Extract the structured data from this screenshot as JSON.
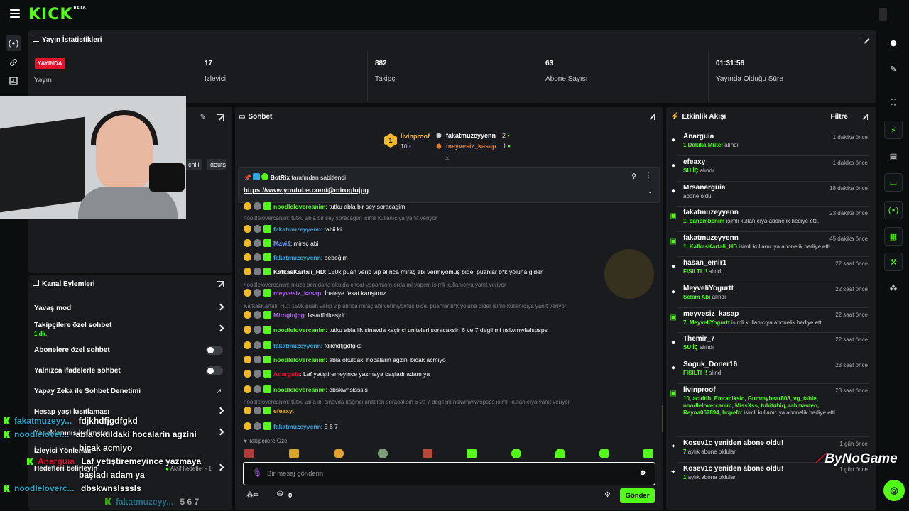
{
  "header": {
    "logo": "KICK",
    "logo_tag": "BETA"
  },
  "stats": {
    "title": "Yayın İstatistikleri",
    "live_badge": "YAYINDA",
    "items": [
      {
        "value": "",
        "label": "Yayın"
      },
      {
        "value": "17",
        "label": "İzleyici"
      },
      {
        "value": "882",
        "label": "Takipçi"
      },
      {
        "value": "63",
        "label": "Abone Sayısı"
      },
      {
        "value": "01:31:56",
        "label": "Yayında Olduğu Süre"
      }
    ]
  },
  "stream_info": {
    "tags": [
      "chill",
      "deuts"
    ]
  },
  "channel_actions": {
    "title": "Kanal Eylemleri",
    "rows": [
      {
        "label": "Yavaş mod",
        "sub": ""
      },
      {
        "label": "Takipçilere özel sohbet",
        "sub": "1 dk."
      },
      {
        "label": "Abonelere özel sohbet",
        "sub": ""
      },
      {
        "label": "Yalnızca ifadelerle sohbet",
        "sub": ""
      },
      {
        "label": "Yapay Zeka ile Sohbet Denetimi",
        "sub": ""
      },
      {
        "label": "Hesap yaşı kısıtlaması",
        "sub": ""
      },
      {
        "label": "Yasaklanmış kelimeler",
        "sub": ""
      },
      {
        "label": "İzleyici Yönlendir",
        "sub": ""
      },
      {
        "label": "Hedefleri belirleyin",
        "sub": ""
      }
    ],
    "goals_active": "Aktif hedefler - 1"
  },
  "overlay_chat": [
    {
      "user": "fakatmuzeyy...",
      "text": "fdjkhdfjgdfgkd"
    },
    {
      "user": "noodlelover...",
      "text": "abla okuldaki hocalarin agzini"
    },
    {
      "user": "",
      "text": "bicak acmiyo"
    },
    {
      "user": "Anarguia",
      "text": "Laf yetiştiremeyince yazmaya"
    },
    {
      "user": "",
      "text": "başladı adam ya"
    },
    {
      "user": "noodleloverc...",
      "text": "dbskwnslsssls"
    },
    {
      "user": "fakatmuzeyy...",
      "text": "5 6 7"
    }
  ],
  "chat": {
    "title": "Sohbet",
    "leaderboard": {
      "first": {
        "name": "livinproof",
        "count": "10"
      },
      "second": {
        "name": "fakatmuzeyyenn",
        "count": "2"
      },
      "third": {
        "name": "meyvesiz_kasap",
        "count": "1"
      }
    },
    "pinned": {
      "by": "BotRix",
      "suffix": "tarafından sabitlendi",
      "link": "https://www.youtube.com/@miroglujpg"
    },
    "messages": [
      {
        "sys": false,
        "user": "noodlelovercanim",
        "color": "#53fc18",
        "text": "tutku abla bir sey soracagim"
      },
      {
        "sys": true,
        "text": "noodlelovercanim: tutku abla bir sey soracagim isimli kullanıcıya yanıt veriyor"
      },
      {
        "sys": false,
        "user": "fakatmuzeyyenn",
        "color": "#2fa8e0",
        "text": "tabii ki"
      },
      {
        "sys": false,
        "user": "Maviš",
        "color": "#6fa0ff",
        "text": "miraç abi"
      },
      {
        "sys": false,
        "user": "fakatmuzeyyenn",
        "color": "#2fa8e0",
        "text": "bebeğim"
      },
      {
        "sys": false,
        "user": "KafkasKartali_HD",
        "color": "#ffffff",
        "text": "150k puan verip vip alınca miraç abi vermiyomuş bide. puanlar b*k yoluna gider"
      },
      {
        "sys": true,
        "text": "noodlelovercanim: muzo ben daha okulda cheat yapamiom orda mi yapcm isimli kullanıcıya yanıt veriyor"
      },
      {
        "sys": false,
        "user": "meyvesiz_kasap",
        "color": "#b35cf7",
        "text": "İhaleye fesat karıştırıız"
      },
      {
        "sys": true,
        "text": "KafkasKartali_HD: 150k puan verip vip alınca miraç abi vermiyomuş bide. puanlar b*k yoluna gider isimli kullanıcıya yanıt veriyor"
      },
      {
        "sys": false,
        "user": "Miroglujpg",
        "color": "#b35cf7",
        "text": "lksadfhlkasjdf"
      },
      {
        "sys": false,
        "user": "noodlelovercanim",
        "color": "#53fc18",
        "text": "tutku abla ilk sinavda kaçinci uniteleri soracaksin 6 ve 7 degil mi nslwmwlwlspsps"
      },
      {
        "sys": false,
        "user": "fakatmuzeyyenn",
        "color": "#2fa8e0",
        "text": "fdjkhdfjgdfgkd"
      },
      {
        "sys": false,
        "user": "noodlelovercanim",
        "color": "#53fc18",
        "text": "abla okuldaki hocalarin agzini bicak acmiyo"
      },
      {
        "sys": false,
        "user": "Anarguia",
        "color": "#e0132b",
        "text": "Laf yetiştiremeyince yazmaya başladı adam ya"
      },
      {
        "sys": false,
        "user": "noodlelovercanim",
        "color": "#53fc18",
        "text": "dbskwnslsssls"
      },
      {
        "sys": true,
        "text": "noodlelovercanim: tutku abla ilk sinavda kaçinci uniteleri soracaksin 6 ve 7 degil mi nslwmwlwlspsps isimli kullanıcıya yanıt veriyor"
      },
      {
        "sys": false,
        "user": "efeaxy",
        "color": "#f0b928",
        "text": ""
      },
      {
        "sys": false,
        "user": "fakatmuzeyyenn",
        "color": "#2fa8e0",
        "text": "5 6 7"
      }
    ],
    "followers_only": "Takipçilere Özel",
    "input_placeholder": "Bir mesaj gönderin",
    "points": "0",
    "send_label": "Gönder"
  },
  "activity": {
    "title": "Etkinlik Akışı",
    "filter": "Filtre",
    "items": [
      {
        "name": "Anarguia",
        "hl": "1 Dakika Mute!",
        "rest": "alındı",
        "time": "1 dakika önce",
        "type": "reward"
      },
      {
        "name": "efeaxy",
        "hl": "SU İÇ",
        "rest": "alındı",
        "time": "1 dakika önce",
        "type": "reward"
      },
      {
        "name": "Mrsanarguia",
        "hl": "",
        "rest": "abone oldu",
        "time": "18 dakika önce",
        "type": "reward"
      },
      {
        "name": "fakatmuzeyyenn",
        "hl": "1, canombenim",
        "rest": "isimli kullanıcıya abonelik hediye etti.",
        "time": "23 dakika önce",
        "type": "gift"
      },
      {
        "name": "fakatmuzeyyenn",
        "hl": "1, KafkasKartali_HD",
        "rest": "isimli kullanıcıya abonelik hediye etti.",
        "time": "45 dakika önce",
        "type": "gift"
      },
      {
        "name": "hasan_emir1",
        "hl": "FISILTI !!",
        "rest": "alındı",
        "time": "22 saat önce",
        "type": "reward"
      },
      {
        "name": "MeyveliYogurtt",
        "hl": "Selam Abi",
        "rest": "alındı",
        "time": "22 saat önce",
        "type": "reward"
      },
      {
        "name": "meyvesiz_kasap",
        "hl": "7, MeyveliYogurtt",
        "rest": "isimli kullanıcıya abonelik hediye etti.",
        "time": "22 saat önce",
        "type": "gift"
      },
      {
        "name": "Themir_7",
        "hl": "SU İÇ",
        "rest": "alındı",
        "time": "22 saat önce",
        "type": "reward"
      },
      {
        "name": "Soguk_Doner16",
        "hl": "FISILTI !!",
        "rest": "alındı",
        "time": "23 saat önce",
        "type": "reward"
      },
      {
        "name": "livinproof",
        "hl": "10, acidtib, Emraniksic, Gummybear808, vg_table, noodlelovercanim, MissXss, tubitubiq, rahmanteo, Reyna067894, hopefrr",
        "rest": "isimli kullanıcıya abonelik hediye etti.",
        "time": "23 saat önce",
        "type": "gift"
      },
      {
        "name": "Kosev1c yeniden abone oldu!",
        "hl": "7",
        "rest": "aylık abone oldular",
        "time": "1 gün önce",
        "type": "sub"
      },
      {
        "name": "Kosev1c yeniden abone oldu!",
        "hl": "1",
        "rest": "aylık abone oldular",
        "time": "1 gün önce",
        "type": "sub"
      }
    ]
  },
  "watermark": "ByNoGame"
}
